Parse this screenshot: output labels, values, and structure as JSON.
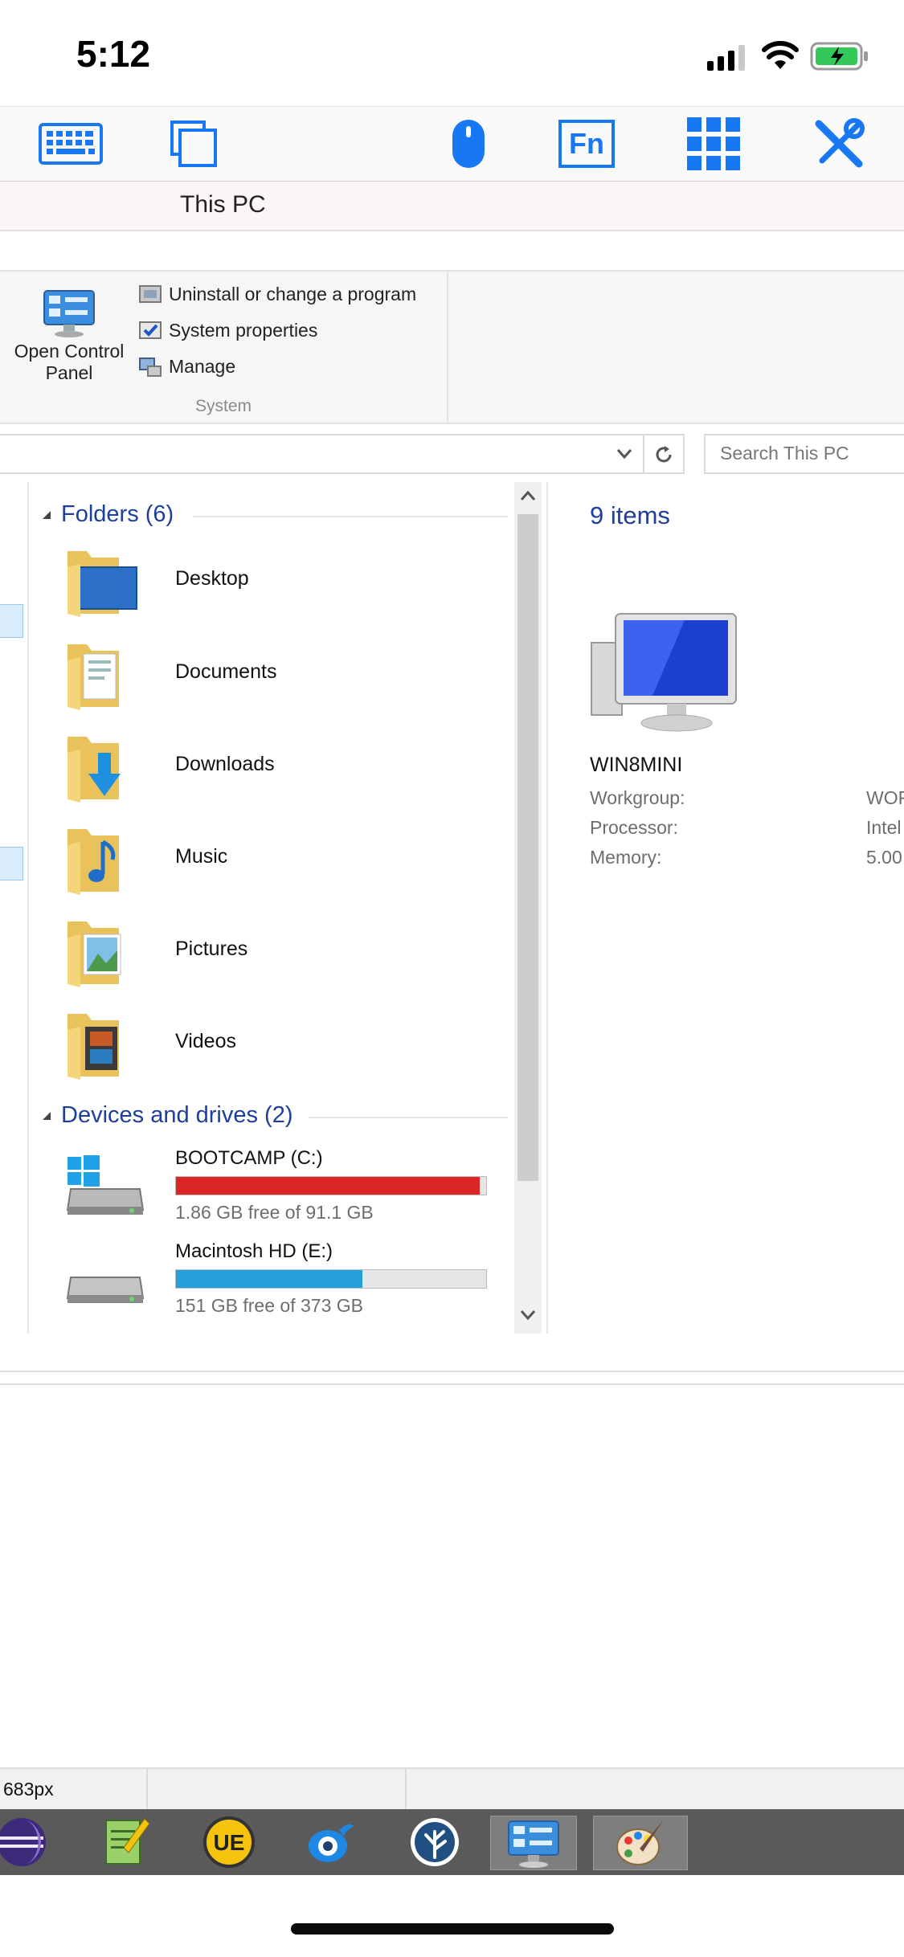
{
  "status_bar": {
    "time": "5:12"
  },
  "remote_toolbar": {
    "buttons": [
      "keyboard-icon",
      "window-switch-icon",
      "mouse-icon",
      "fn-key-icon",
      "apps-grid-icon",
      "tools-icon"
    ],
    "fn_label": "Fn",
    "accent": "#1877f2"
  },
  "window": {
    "title": "This PC"
  },
  "ribbon": {
    "open_control_panel": "Open Control Panel",
    "links": [
      "Uninstall or change a program",
      "System properties",
      "Manage"
    ],
    "group_label": "System"
  },
  "search": {
    "placeholder": "Search This PC"
  },
  "content": {
    "folders_header": "Folders (6)",
    "folders": [
      "Desktop",
      "Documents",
      "Downloads",
      "Music",
      "Pictures",
      "Videos"
    ],
    "drives_header": "Devices and drives (2)",
    "drives": [
      {
        "name": "BOOTCAMP (C:)",
        "free": "1.86 GB free of 91.1 GB",
        "used_fraction": 0.98,
        "bar_color": "#da2626"
      },
      {
        "name": "Macintosh HD (E:)",
        "free": "151 GB free of 373 GB",
        "used_fraction": 0.6,
        "bar_color": "#26a0da"
      }
    ]
  },
  "details": {
    "items_count": "9 items",
    "pc_name": "WIN8MINI",
    "properties": [
      {
        "label": "Workgroup:",
        "value": "WOR"
      },
      {
        "label": "Processor:",
        "value": "Intel"
      },
      {
        "label": "Memory:",
        "value": "5.00"
      }
    ]
  },
  "statusbar": {
    "text": "683px"
  },
  "taskbar": {
    "apps": [
      "eclipse-icon",
      "notepad-plus-icon",
      "ultraedit-icon",
      "bird-app-icon",
      "sourcetree-icon",
      "control-panel-icon",
      "paint-icon"
    ]
  }
}
